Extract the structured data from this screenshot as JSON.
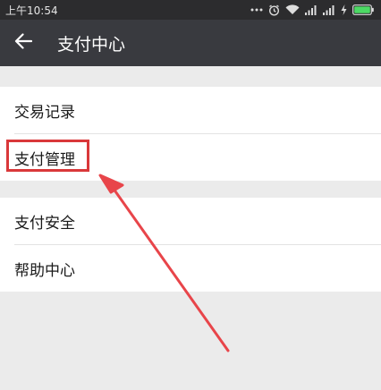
{
  "status_bar": {
    "time": "上午10:54",
    "icons": [
      "dots-icon",
      "alarm-icon",
      "wifi-icon",
      "signal-icon",
      "signal-icon",
      "charging-icon",
      "battery-icon"
    ]
  },
  "app_bar": {
    "back_icon": "back-arrow-icon",
    "title": "支付中心"
  },
  "groups": [
    {
      "items": [
        {
          "label": "交易记录"
        },
        {
          "label": "支付管理"
        }
      ]
    },
    {
      "items": [
        {
          "label": "支付安全"
        },
        {
          "label": "帮助中心"
        }
      ]
    }
  ],
  "colors": {
    "status_bar_bg": "#2c2c2e",
    "app_bar_bg": "#393a3f",
    "page_bg": "#ebebeb",
    "annotation_red": "#d9383a",
    "battery_green": "#4cd964"
  }
}
